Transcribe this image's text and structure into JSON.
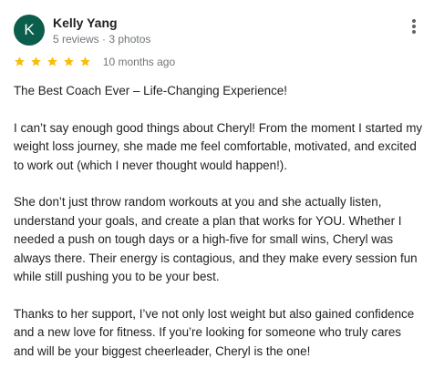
{
  "reviewer": {
    "initial": "K",
    "name": "Kelly Yang",
    "meta": "5 reviews · 3 photos",
    "avatar_color": "#0b5e4c"
  },
  "menu_icon": "more-vert-icon",
  "rating": {
    "stars": 5,
    "star_color": "#fbbc04",
    "date": "10 months ago"
  },
  "review": {
    "title": "The Best Coach Ever – Life-Changing Experience!",
    "paragraphs": [
      "I can’t say enough good things about Cheryl! From the moment I started my weight loss journey, she made me feel comfortable, motivated, and excited to work out (which I never thought would happen!).",
      "She don’t just throw random workouts at you and she actually listen, understand your goals, and create a plan that works for YOU. Whether I needed a push on tough days or a high-five for small wins, Cheryl was always there. Their energy is contagious, and they make every session fun while still pushing you to be your best.",
      "Thanks to her support, I’ve not only lost weight but also gained confidence and a new love for fitness. If you’re looking for someone who truly cares and will be your biggest cheerleader, Cheryl is the one!"
    ]
  }
}
